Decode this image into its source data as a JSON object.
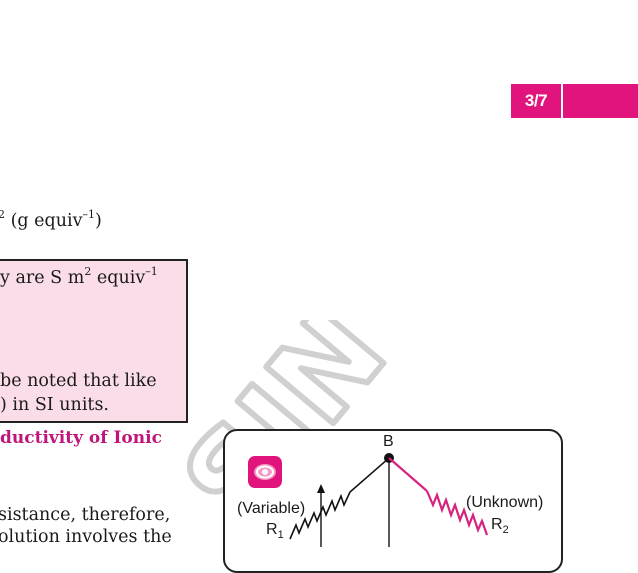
{
  "header": {
    "page_number": "3/7"
  },
  "text": {
    "unit_line": {
      "prefix": "2",
      "middle": " (g equiv",
      "sup": "–1",
      "suffix": ")"
    },
    "box_line1": {
      "text": "y are S m",
      "sup1": "2",
      "mid": " equiv",
      "sup2": "–1"
    },
    "box_line2": "be noted that like",
    "box_line3": ") in SI units.",
    "section_heading": "ductivity of Ionic",
    "body_line1": "sistance, therefore,",
    "body_line2": "olution involves the"
  },
  "figure": {
    "node_b": "B",
    "left_label": "(Variable)",
    "left_resistor": "R",
    "left_sub": "1",
    "right_label": "(Unknown)",
    "right_resistor": "R",
    "right_sub": "2",
    "icon": "eye-icon"
  },
  "colors": {
    "accent": "#e0147c",
    "box_fill": "#fbdde9",
    "heading": "#c0157a"
  }
}
